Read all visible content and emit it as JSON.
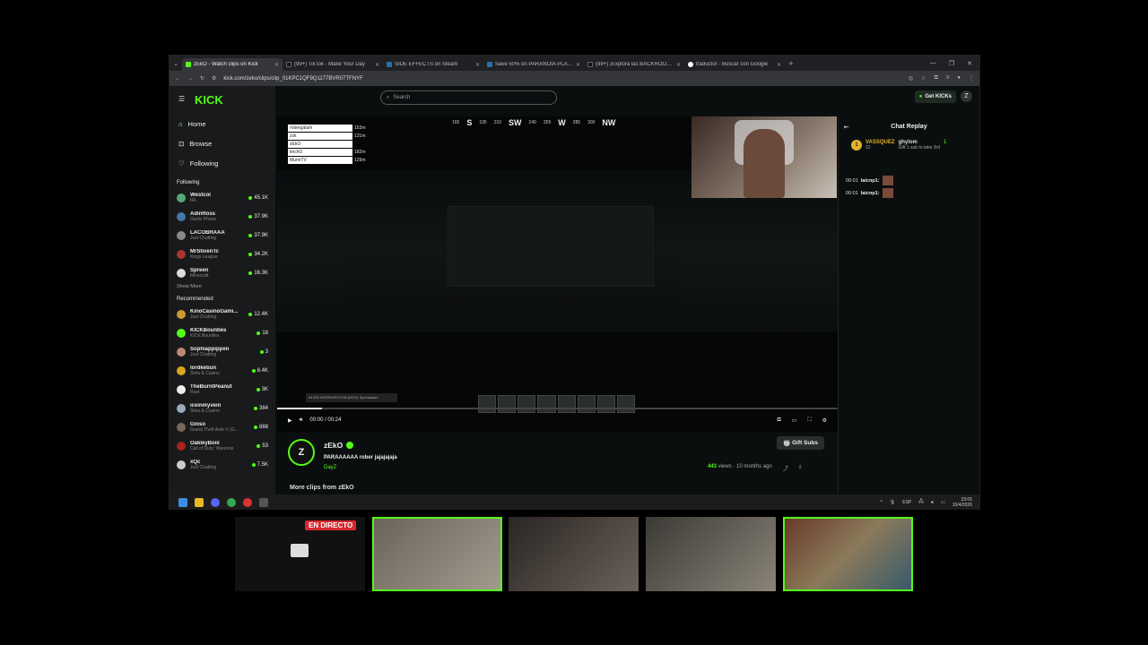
{
  "browser": {
    "tabs": [
      {
        "title": "zEkO - Watch clips on Kick",
        "active": true
      },
      {
        "title": "(99+) TikTok - Make Your Day",
        "active": false
      },
      {
        "title": "SIDE EFFECTS on Steam",
        "active": false
      },
      {
        "title": "Save 50% on PARANOIA PLACE",
        "active": false
      },
      {
        "title": "(99+) ¡Explora las BACKROOMS!",
        "active": false
      },
      {
        "title": "traductor - Buscar con Google",
        "active": false
      }
    ],
    "new_tab": "+",
    "url": "kick.com/zeko/clips/clip_01KPC1QF9Q1177BVR07TFNYF"
  },
  "site": {
    "logo": "KICK",
    "search_placeholder": "Search",
    "get_kicks": "Get KICKs",
    "nav": [
      {
        "label": "Home",
        "icon": "home-icon"
      },
      {
        "label": "Browse",
        "icon": "browse-icon"
      },
      {
        "label": "Following",
        "icon": "heart-icon"
      }
    ],
    "following_header": "Following",
    "following": [
      {
        "name": "Westcol",
        "category": "IRL",
        "viewers": "45.1K"
      },
      {
        "name": "AdinRoss",
        "category": "Gartic Phone",
        "viewers": "37.9K"
      },
      {
        "name": "LACOBRAAA",
        "category": "Just Chatting",
        "viewers": "37.9K"
      },
      {
        "name": "MrStivenTc",
        "category": "Kings League",
        "viewers": "34.2K"
      },
      {
        "name": "Spreen",
        "category": "Minecraft",
        "viewers": "16.3K"
      }
    ],
    "show_more": "Show More",
    "recommended_header": "Recommended",
    "recommended": [
      {
        "name": "KinoCasinoGami...",
        "category": "Just Chatting",
        "viewers": "12.4K"
      },
      {
        "name": "KICKBounties",
        "category": "KICK Bounties",
        "viewers": "18"
      },
      {
        "name": "Sophiappippen",
        "category": "Just Chatting",
        "viewers": "3"
      },
      {
        "name": "lordkebun",
        "category": "Slots & Casino",
        "viewers": "8.4K"
      },
      {
        "name": "TheBurntPeanut",
        "category": "Rust",
        "viewers": "3K"
      },
      {
        "name": "iceinmyvein",
        "category": "Slots & Casino",
        "viewers": "384"
      },
      {
        "name": "Gioso",
        "category": "Grand Theft Auto V (G...",
        "viewers": "888"
      },
      {
        "name": "OakleyBoiii",
        "category": "Call of Duty: Warzone",
        "viewers": "53"
      },
      {
        "name": "xQc",
        "category": "Just Chatting",
        "viewers": "7.5K"
      }
    ]
  },
  "video": {
    "compass": [
      "S",
      "195",
      "210",
      "SW",
      "240",
      "255",
      "W",
      "285",
      "300",
      "NW"
    ],
    "compass_left": "165",
    "leaderboard": [
      {
        "name": "robergalam",
        "dist": "153m"
      },
      {
        "name": "zzk",
        "dist": "131m"
      },
      {
        "name": "zEkO",
        "dist": ""
      },
      {
        "name": "tinchO",
        "dist": "182m"
      },
      {
        "name": "MunnTV",
        "dist": "129m"
      }
    ],
    "mission_text": "IN 200 INTERVENTION (DOG) Spectaction",
    "time": "00:00 / 00:24",
    "progress": 0.08
  },
  "chat": {
    "title": "Chat Replay",
    "gift": {
      "badge": "1",
      "user": "VASSQUEZ",
      "level": "12",
      "recipient": "ghylom",
      "count": "1",
      "text": "Gift 1 sub to take 3rd"
    },
    "messages": [
      {
        "time": "00:01",
        "user": "laicnp1:"
      },
      {
        "time": "00:01",
        "user": "laicnp1:"
      }
    ]
  },
  "clip": {
    "channel": "zEkO",
    "avatar_letter": "Z",
    "title": "PARAAAAAA rober jajajajaja",
    "category": "DayZ",
    "views": "443",
    "views_label": "views",
    "age": "10 months ago",
    "gift_subs": "Gift Subs",
    "more_clips": "More clips from zEkO"
  },
  "taskbar": {
    "lang": "ESP",
    "time": "23:05",
    "date": "10/4/2026"
  },
  "overlay": {
    "live_badge": "EN DIRECTO"
  },
  "colors": {
    "accent": "#53fc18",
    "gold": "#e2b32a",
    "live": "#d7282f"
  }
}
